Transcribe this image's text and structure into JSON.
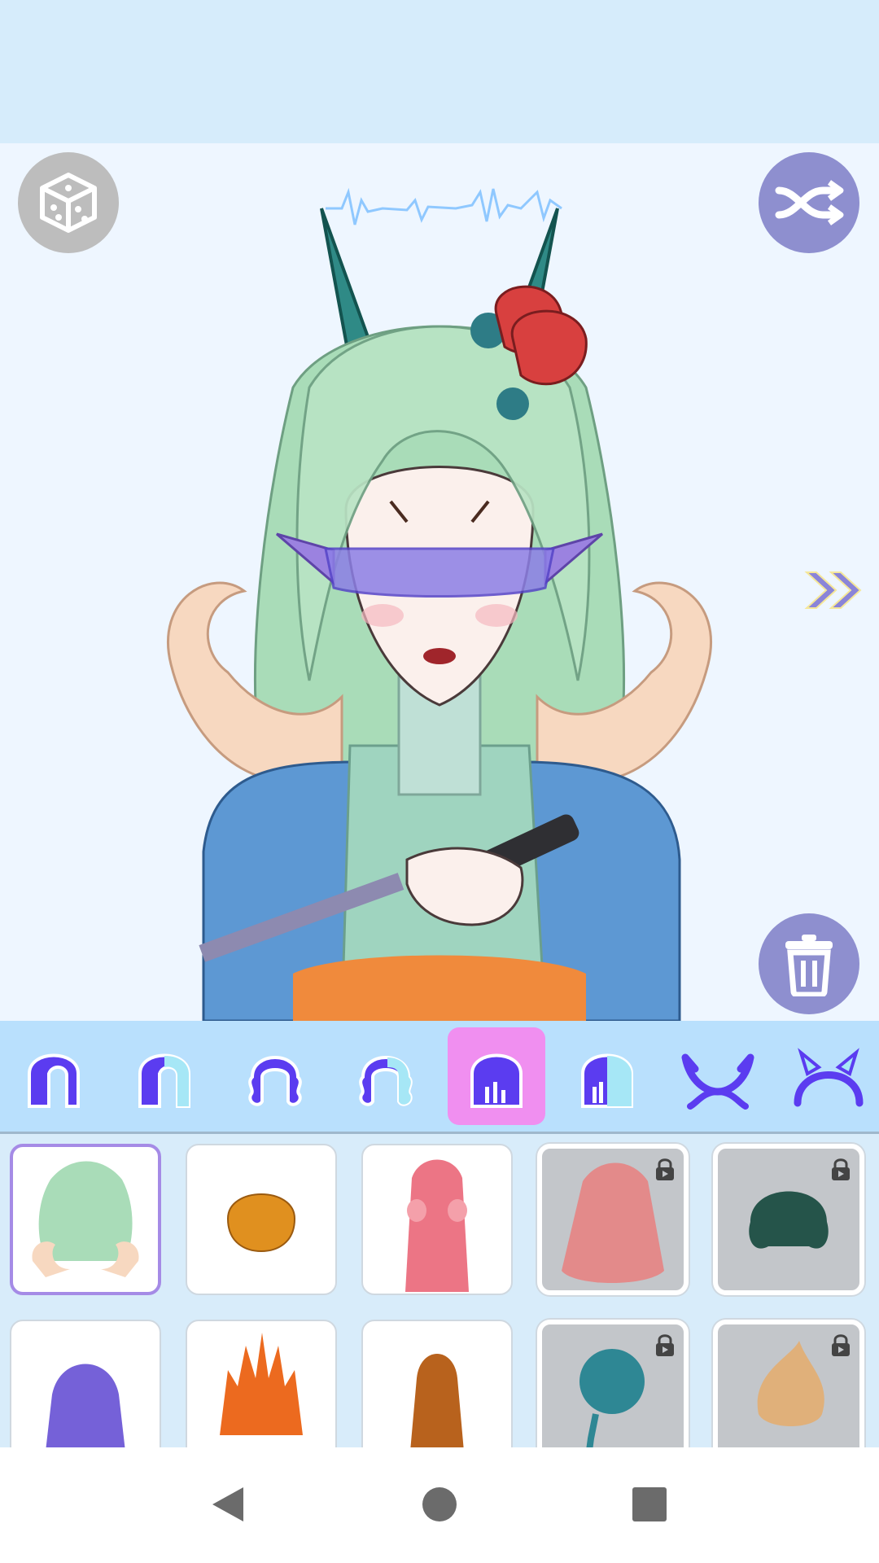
{
  "app": {
    "screen": "hair-editor"
  },
  "toolbar": {
    "random_icon": "dice-icon",
    "shuffle_icon": "shuffle-icon",
    "next_icon": "double-chevron-right-icon",
    "delete_icon": "trash-icon"
  },
  "category_tabs": [
    {
      "icon": "hair-front-icon",
      "selected": false
    },
    {
      "icon": "hair-front-color-icon",
      "selected": false
    },
    {
      "icon": "hair-curly-icon",
      "selected": false
    },
    {
      "icon": "hair-curly-color-icon",
      "selected": false
    },
    {
      "icon": "hair-back-icon",
      "selected": true
    },
    {
      "icon": "hair-back-color-icon",
      "selected": false
    },
    {
      "icon": "horns-icon",
      "selected": false
    },
    {
      "icon": "headband-icon",
      "selected": false
    }
  ],
  "hair_items": [
    {
      "name": "mint-curly-long",
      "locked": false,
      "selected": true
    },
    {
      "name": "orange-bob",
      "locked": false,
      "selected": false
    },
    {
      "name": "pink-twin-ribbons",
      "locked": false,
      "selected": false
    },
    {
      "name": "rose-wavy-long",
      "locked": true,
      "selected": false
    },
    {
      "name": "dark-teal-bob",
      "locked": true,
      "selected": false
    },
    {
      "name": "purple-layered",
      "locked": false,
      "selected": false
    },
    {
      "name": "orange-spiky",
      "locked": false,
      "selected": false
    },
    {
      "name": "brown-ponytail",
      "locked": false,
      "selected": false
    },
    {
      "name": "teal-braid",
      "locked": true,
      "selected": false
    },
    {
      "name": "tan-swirl",
      "locked": true,
      "selected": false
    }
  ],
  "system_nav": {
    "back_icon": "back-triangle-icon",
    "home_icon": "home-circle-icon",
    "recents_icon": "recents-square-icon"
  },
  "colors": {
    "accent": "#5b3cf0",
    "tab_selected": "#f08ff0",
    "tab_bar": "#b9e0fd",
    "button_purple": "#8e8fcf",
    "button_gray": "#bdbdbd"
  }
}
